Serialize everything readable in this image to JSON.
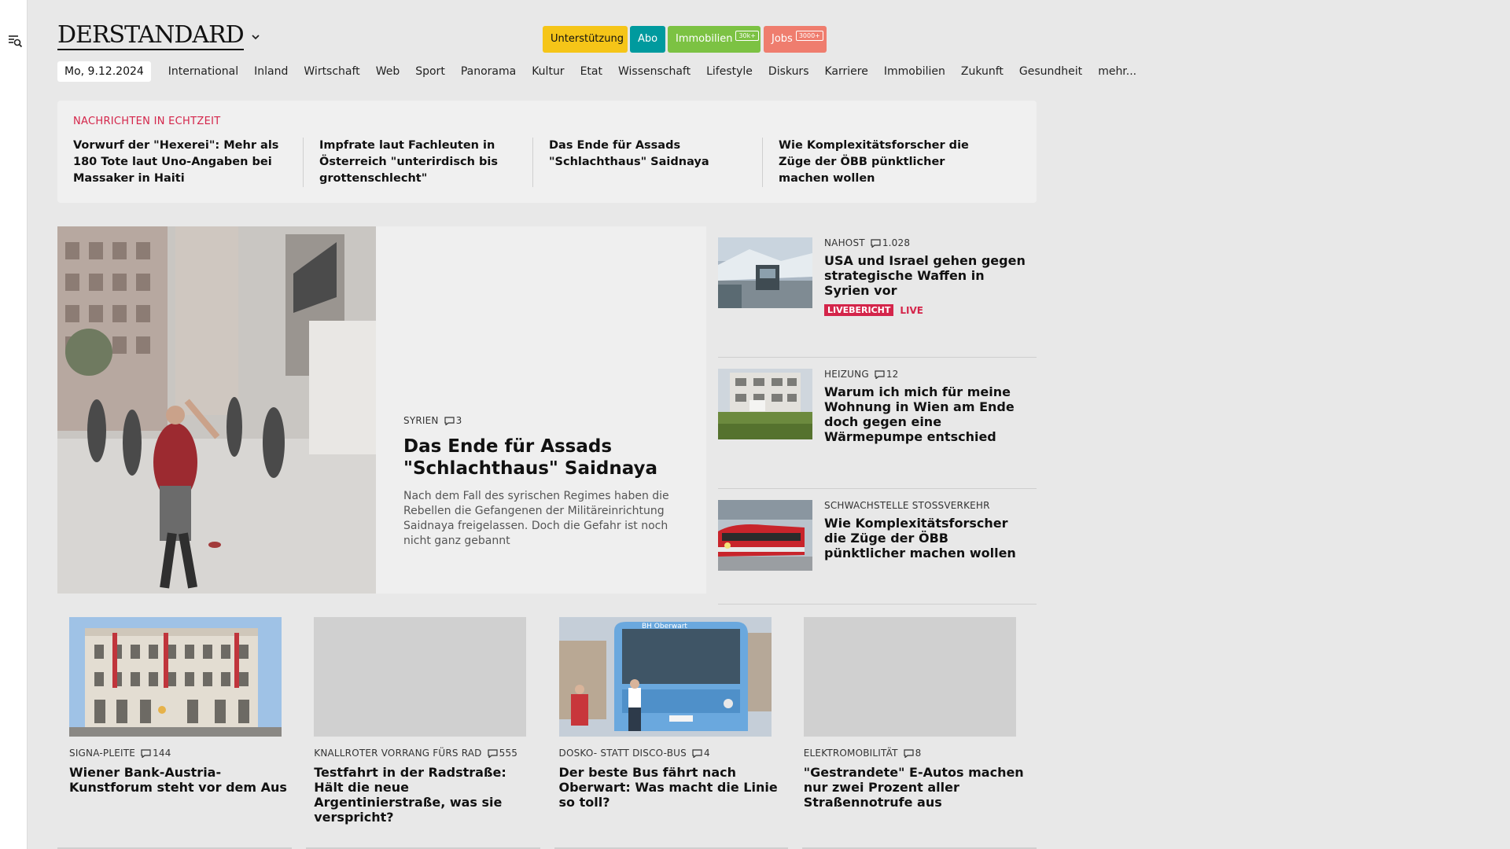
{
  "brand": {
    "logo": "DERSTANDARD"
  },
  "topbuttons": {
    "unterstuetzung": "Unterstützung",
    "abo": "Abo",
    "immobilien": "Immobilien",
    "immobilien_badge": "30k+",
    "jobs": "Jobs",
    "jobs_badge": "3000+"
  },
  "nav": {
    "date": "Mo, 9.12.2024",
    "items": [
      "International",
      "Inland",
      "Wirtschaft",
      "Web",
      "Sport",
      "Panorama",
      "Kultur",
      "Etat",
      "Wissenschaft",
      "Lifestyle",
      "Diskurs",
      "Karriere",
      "Immobilien",
      "Zukunft",
      "Gesundheit",
      "mehr..."
    ]
  },
  "ticker": {
    "label": "NACHRICHTEN IN ECHTZEIT",
    "items": [
      "Vorwurf der \"Hexerei\": Mehr als 180 Tote laut Uno-Angaben bei Massaker in Haiti",
      "Impfrate laut Fachleuten in Österreich \"unterirdisch bis grottenschlecht\"",
      "Das Ende für Assads \"Schlachthaus\" Saidnaya",
      "Wie Komplexitätsforscher die Züge der ÖBB pünktlicher machen wollen"
    ]
  },
  "lead": {
    "kicker": "SYRIEN",
    "comments": "3",
    "title": "Das Ende für Assads \"Schlachthaus\" Saidnaya",
    "teaser": "Nach dem Fall des syrischen Regimes haben die Rebellen die Gefangenen der Militäreinrichtung Saidnaya freigelassen. Doch die Gefahr ist noch nicht ganz gebannt"
  },
  "side": [
    {
      "kicker": "NAHOST",
      "comments": "1.028",
      "title": "USA und Israel gehen gegen strategische Waffen in Syrien vor",
      "live_badge": "LIVEBERICHT",
      "live_text": "LIVE"
    },
    {
      "kicker": "HEIZUNG",
      "comments": "12",
      "title": "Warum ich mich für meine Wohnung in Wien am Ende doch gegen eine Wärmepumpe entschied"
    },
    {
      "kicker": "SCHWACHSTELLE STOSSVERKEHR",
      "comments": "",
      "title": "Wie Komplexitätsforscher die Züge der ÖBB pünktlicher machen wollen"
    }
  ],
  "cards": [
    {
      "kicker": "SIGNA-PLEITE",
      "comments": "144",
      "title": "Wiener Bank-Austria-Kunstforum steht vor dem Aus"
    },
    {
      "kicker": "KNALLROTER VORRANG FÜRS RAD",
      "comments": "555",
      "title": "Testfahrt in der Radstraße: Hält die neue Argentinierstraße, was sie verspricht?"
    },
    {
      "kicker": "DOSKO- STATT DISCO-BUS",
      "comments": "4",
      "title": "Der beste Bus fährt nach Oberwart: Was macht die Linie so toll?"
    },
    {
      "kicker": "ELEKTROMOBILITÄT",
      "comments": "8",
      "title": "\"Gestrandete\" E-Autos machen nur zwei Prozent aller Straßennotrufe aus"
    }
  ],
  "bus_sign": "BH Oberwart",
  "colors": {
    "accent_red": "#d4254a",
    "abo_teal": "#009a9e",
    "immo_green": "#7cc243",
    "jobs_salmon": "#ef7d6e",
    "support_yellow": "#f5c518"
  }
}
